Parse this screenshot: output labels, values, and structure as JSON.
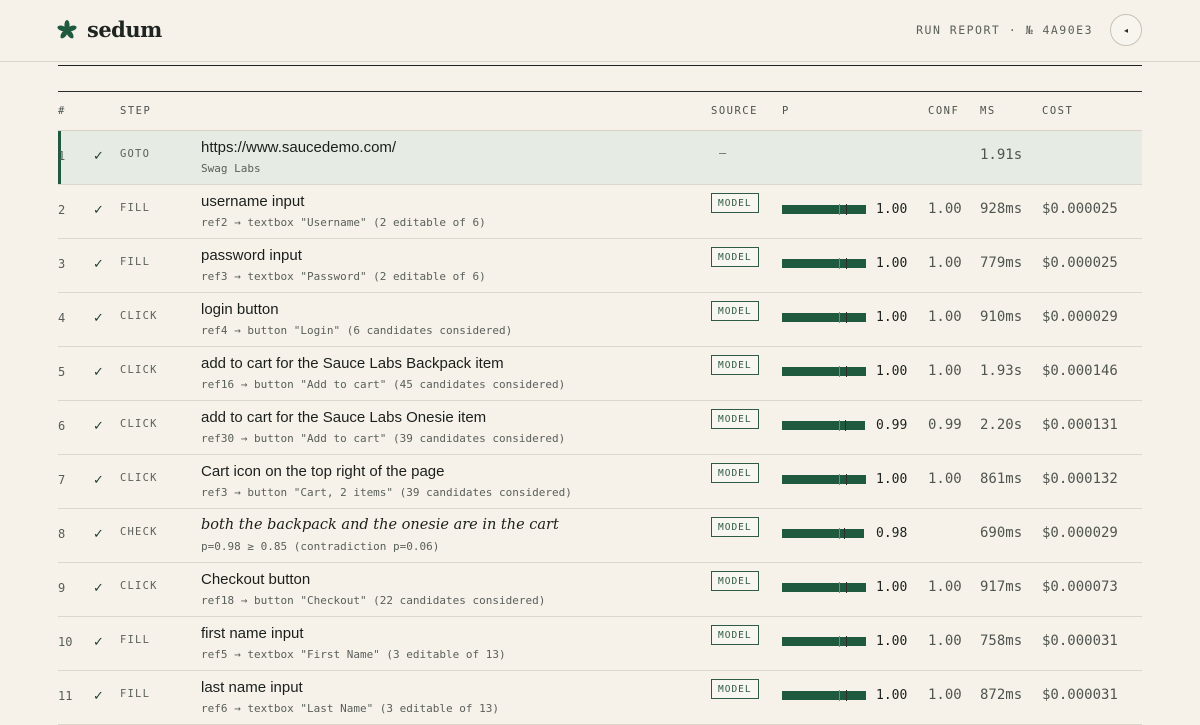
{
  "app": {
    "name": "sedum"
  },
  "header": {
    "run_label": "RUN REPORT · № 4A90E3",
    "toggle_glyph": "◂"
  },
  "table": {
    "columns": {
      "num": "#",
      "step": "STEP",
      "source": "SOURCE",
      "p": "P",
      "conf": "CONF",
      "ms": "MS",
      "cost": "COST"
    },
    "rows": [
      {
        "num": "1",
        "status": "✓",
        "kind": "GOTO",
        "title": "https://www.saucedemo.com/",
        "subtitle": "Swag Labs",
        "source": "—",
        "source_type": "dash",
        "p": null,
        "p_label": "",
        "conf": "",
        "ms": "1.91s",
        "cost": "",
        "active": true,
        "italic": false
      },
      {
        "num": "2",
        "status": "✓",
        "kind": "FILL",
        "title": "username input",
        "subtitle": "ref2 → textbox \"Username\" (2 editable of 6)",
        "source": "MODEL",
        "source_type": "badge",
        "p": 1.0,
        "p_label": "1.00",
        "conf": "1.00",
        "ms": "928ms",
        "cost": "$0.000025",
        "active": false,
        "italic": false
      },
      {
        "num": "3",
        "status": "✓",
        "kind": "FILL",
        "title": "password input",
        "subtitle": "ref3 → textbox \"Password\" (2 editable of 6)",
        "source": "MODEL",
        "source_type": "badge",
        "p": 1.0,
        "p_label": "1.00",
        "conf": "1.00",
        "ms": "779ms",
        "cost": "$0.000025",
        "active": false,
        "italic": false
      },
      {
        "num": "4",
        "status": "✓",
        "kind": "CLICK",
        "title": "login button",
        "subtitle": "ref4 → button \"Login\" (6 candidates considered)",
        "source": "MODEL",
        "source_type": "badge",
        "p": 1.0,
        "p_label": "1.00",
        "conf": "1.00",
        "ms": "910ms",
        "cost": "$0.000029",
        "active": false,
        "italic": false
      },
      {
        "num": "5",
        "status": "✓",
        "kind": "CLICK",
        "title": "add to cart for the Sauce Labs Backpack item",
        "subtitle": "ref16 → button \"Add to cart\" (45 candidates considered)",
        "source": "MODEL",
        "source_type": "badge",
        "p": 1.0,
        "p_label": "1.00",
        "conf": "1.00",
        "ms": "1.93s",
        "cost": "$0.000146",
        "active": false,
        "italic": false
      },
      {
        "num": "6",
        "status": "✓",
        "kind": "CLICK",
        "title": "add to cart for the Sauce Labs Onesie item",
        "subtitle": "ref30 → button \"Add to cart\" (39 candidates considered)",
        "source": "MODEL",
        "source_type": "badge",
        "p": 0.99,
        "p_label": "0.99",
        "conf": "0.99",
        "ms": "2.20s",
        "cost": "$0.000131",
        "active": false,
        "italic": false
      },
      {
        "num": "7",
        "status": "✓",
        "kind": "CLICK",
        "title": "Cart icon on the top right of the page",
        "subtitle": "ref3 → button \"Cart, 2 items\" (39 candidates considered)",
        "source": "MODEL",
        "source_type": "badge",
        "p": 1.0,
        "p_label": "1.00",
        "conf": "1.00",
        "ms": "861ms",
        "cost": "$0.000132",
        "active": false,
        "italic": false
      },
      {
        "num": "8",
        "status": "✓",
        "kind": "CHECK",
        "title": "both the backpack and the onesie are in the cart",
        "subtitle": "p=0.98 ≥ 0.85 (contradiction p=0.06)",
        "source": "MODEL",
        "source_type": "badge",
        "p": 0.98,
        "p_label": "0.98",
        "conf": "",
        "ms": "690ms",
        "cost": "$0.000029",
        "active": false,
        "italic": true
      },
      {
        "num": "9",
        "status": "✓",
        "kind": "CLICK",
        "title": "Checkout button",
        "subtitle": "ref18 → button \"Checkout\" (22 candidates considered)",
        "source": "MODEL",
        "source_type": "badge",
        "p": 1.0,
        "p_label": "1.00",
        "conf": "1.00",
        "ms": "917ms",
        "cost": "$0.000073",
        "active": false,
        "italic": false
      },
      {
        "num": "10",
        "status": "✓",
        "kind": "FILL",
        "title": "first name input",
        "subtitle": "ref5 → textbox \"First Name\" (3 editable of 13)",
        "source": "MODEL",
        "source_type": "badge",
        "p": 1.0,
        "p_label": "1.00",
        "conf": "1.00",
        "ms": "758ms",
        "cost": "$0.000031",
        "active": false,
        "italic": false
      },
      {
        "num": "11",
        "status": "✓",
        "kind": "FILL",
        "title": "last name input",
        "subtitle": "ref6 → textbox \"Last Name\" (3 editable of 13)",
        "source": "MODEL",
        "source_type": "badge",
        "p": 1.0,
        "p_label": "1.00",
        "conf": "1.00",
        "ms": "872ms",
        "cost": "$0.000031",
        "active": false,
        "italic": false
      }
    ]
  },
  "colors": {
    "brand": "#1f5a3e",
    "background": "#f6f2ea",
    "active_row": "#e6ebe3",
    "threshold_tick": "#c96a3c"
  }
}
